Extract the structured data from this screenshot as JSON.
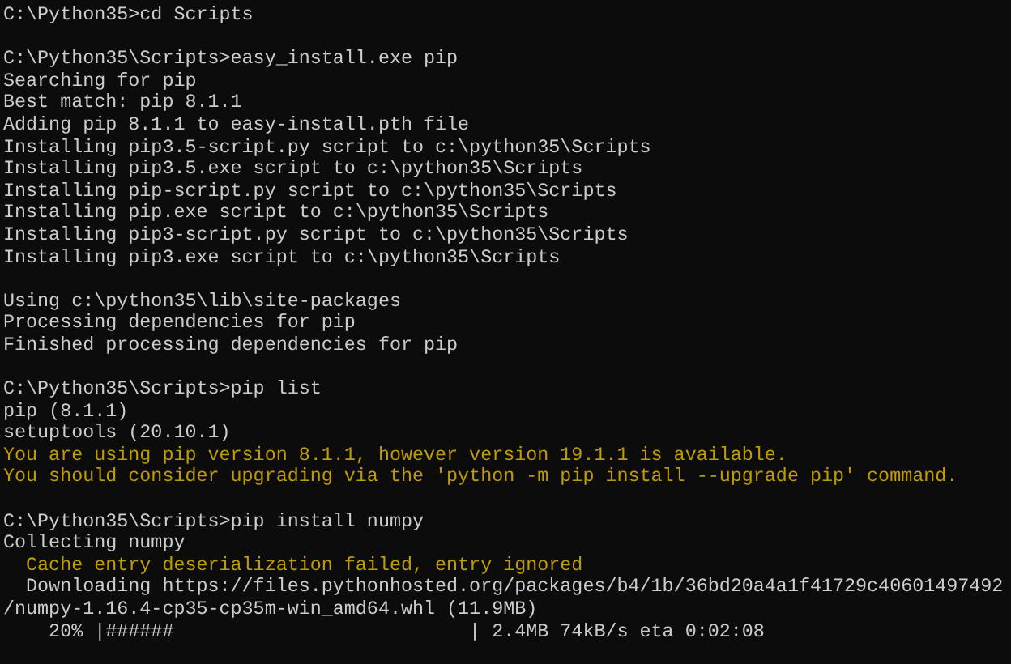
{
  "console_lines": [
    {
      "kind": "prompt",
      "text": "C:\\Python35>cd Scripts"
    },
    {
      "kind": "blank"
    },
    {
      "kind": "prompt",
      "text": "C:\\Python35\\Scripts>easy_install.exe pip"
    },
    {
      "kind": "output",
      "text": "Searching for pip"
    },
    {
      "kind": "output",
      "text": "Best match: pip 8.1.1"
    },
    {
      "kind": "output",
      "text": "Adding pip 8.1.1 to easy-install.pth file"
    },
    {
      "kind": "output",
      "text": "Installing pip3.5-script.py script to c:\\python35\\Scripts"
    },
    {
      "kind": "output",
      "text": "Installing pip3.5.exe script to c:\\python35\\Scripts"
    },
    {
      "kind": "output",
      "text": "Installing pip-script.py script to c:\\python35\\Scripts"
    },
    {
      "kind": "output",
      "text": "Installing pip.exe script to c:\\python35\\Scripts"
    },
    {
      "kind": "output",
      "text": "Installing pip3-script.py script to c:\\python35\\Scripts"
    },
    {
      "kind": "output",
      "text": "Installing pip3.exe script to c:\\python35\\Scripts"
    },
    {
      "kind": "blank"
    },
    {
      "kind": "output",
      "text": "Using c:\\python35\\lib\\site-packages"
    },
    {
      "kind": "output",
      "text": "Processing dependencies for pip"
    },
    {
      "kind": "output",
      "text": "Finished processing dependencies for pip"
    },
    {
      "kind": "blank"
    },
    {
      "kind": "prompt",
      "text": "C:\\Python35\\Scripts>pip list"
    },
    {
      "kind": "output",
      "text": "pip (8.1.1)"
    },
    {
      "kind": "output",
      "text": "setuptools (20.10.1)"
    },
    {
      "kind": "warning",
      "text": "You are using pip version 8.1.1, however version 19.1.1 is available."
    },
    {
      "kind": "warning",
      "text": "You should consider upgrading via the 'python -m pip install --upgrade pip' command."
    },
    {
      "kind": "blank"
    },
    {
      "kind": "prompt",
      "text": "C:\\Python35\\Scripts>pip install numpy"
    },
    {
      "kind": "output",
      "text": "Collecting numpy"
    },
    {
      "kind": "warning",
      "text": "  Cache entry deserialization failed, entry ignored"
    },
    {
      "kind": "output",
      "text": "  Downloading https://files.pythonhosted.org/packages/b4/1b/36bd20a4a1f41729c40601497492"
    },
    {
      "kind": "output",
      "text": "/numpy-1.16.4-cp35-cp35m-win_amd64.whl (11.9MB)"
    },
    {
      "kind": "output",
      "text": "    20% |######                          | 2.4MB 74kB/s eta 0:02:08"
    }
  ]
}
